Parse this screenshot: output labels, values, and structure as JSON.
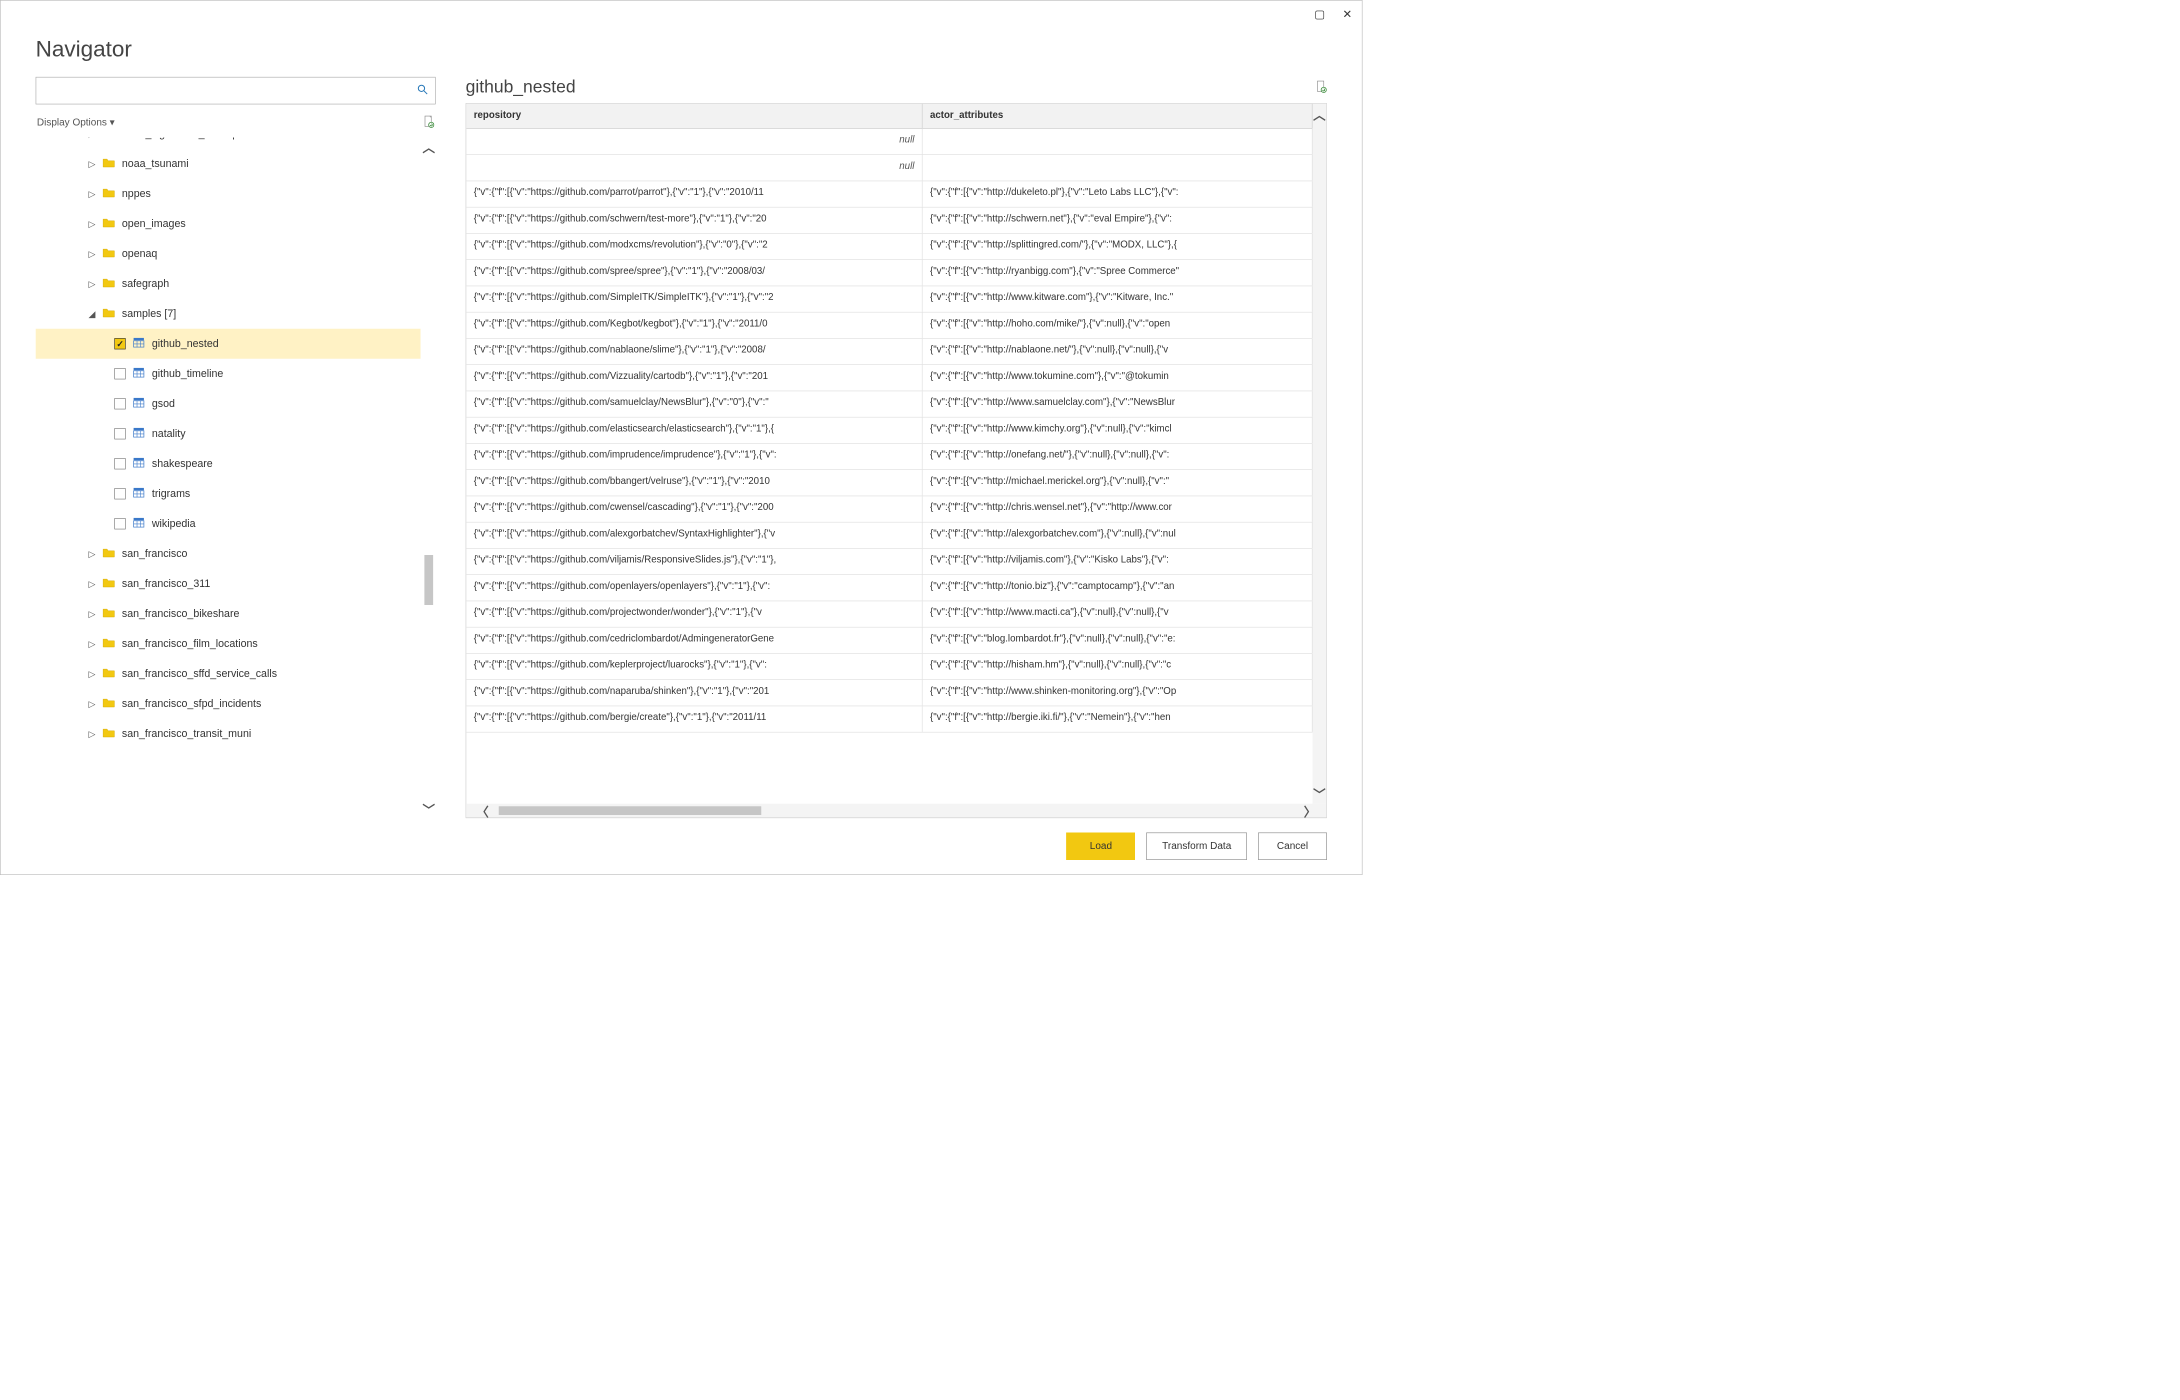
{
  "window": {
    "title": "Navigator",
    "display_options": "Display Options ▾",
    "search_placeholder": ""
  },
  "tree": {
    "items": [
      {
        "level": 2,
        "arrow": "▷",
        "kind": "folder",
        "label": "noaa_significant_earthquakes",
        "trunc": true
      },
      {
        "level": 2,
        "arrow": "▷",
        "kind": "folder",
        "label": "noaa_tsunami"
      },
      {
        "level": 2,
        "arrow": "▷",
        "kind": "folder",
        "label": "nppes"
      },
      {
        "level": 2,
        "arrow": "▷",
        "kind": "folder",
        "label": "open_images"
      },
      {
        "level": 2,
        "arrow": "▷",
        "kind": "folder",
        "label": "openaq"
      },
      {
        "level": 2,
        "arrow": "▷",
        "kind": "folder",
        "label": "safegraph"
      },
      {
        "level": 2,
        "arrow": "◢",
        "kind": "folder",
        "label": "samples [7]"
      },
      {
        "level": 3,
        "kind": "table",
        "checked": true,
        "label": "github_nested",
        "selected": true
      },
      {
        "level": 3,
        "kind": "table",
        "checked": false,
        "label": "github_timeline"
      },
      {
        "level": 3,
        "kind": "table",
        "checked": false,
        "label": "gsod"
      },
      {
        "level": 3,
        "kind": "table",
        "checked": false,
        "label": "natality"
      },
      {
        "level": 3,
        "kind": "table",
        "checked": false,
        "label": "shakespeare"
      },
      {
        "level": 3,
        "kind": "table",
        "checked": false,
        "label": "trigrams"
      },
      {
        "level": 3,
        "kind": "table",
        "checked": false,
        "label": "wikipedia"
      },
      {
        "level": 2,
        "arrow": "▷",
        "kind": "folder",
        "label": "san_francisco"
      },
      {
        "level": 2,
        "arrow": "▷",
        "kind": "folder",
        "label": "san_francisco_311"
      },
      {
        "level": 2,
        "arrow": "▷",
        "kind": "folder",
        "label": "san_francisco_bikeshare"
      },
      {
        "level": 2,
        "arrow": "▷",
        "kind": "folder",
        "label": "san_francisco_film_locations"
      },
      {
        "level": 2,
        "arrow": "▷",
        "kind": "folder",
        "label": "san_francisco_sffd_service_calls"
      },
      {
        "level": 2,
        "arrow": "▷",
        "kind": "folder",
        "label": "san_francisco_sfpd_incidents"
      },
      {
        "level": 2,
        "arrow": "▷",
        "kind": "folder",
        "label": "san_francisco_transit_muni",
        "partial": true
      }
    ]
  },
  "preview": {
    "title": "github_nested",
    "columns": [
      "repository",
      "actor_attributes"
    ],
    "rows": [
      {
        "repository": "null",
        "actor_attributes": "",
        "nullrow": true
      },
      {
        "repository": "null",
        "actor_attributes": "",
        "nullrow": true
      },
      {
        "repository": "{\"v\":{\"f\":[{\"v\":\"https://github.com/parrot/parrot\"},{\"v\":\"1\"},{\"v\":\"2010/11",
        "actor_attributes": "{\"v\":{\"f\":[{\"v\":\"http://dukeleto.pl\"},{\"v\":\"Leto Labs LLC\"},{\"v\":"
      },
      {
        "repository": "{\"v\":{\"f\":[{\"v\":\"https://github.com/schwern/test-more\"},{\"v\":\"1\"},{\"v\":\"20",
        "actor_attributes": "{\"v\":{\"f\":[{\"v\":\"http://schwern.net\"},{\"v\":\"eval Empire\"},{\"v\":"
      },
      {
        "repository": "{\"v\":{\"f\":[{\"v\":\"https://github.com/modxcms/revolution\"},{\"v\":\"0\"},{\"v\":\"2",
        "actor_attributes": "{\"v\":{\"f\":[{\"v\":\"http://splittingred.com/\"},{\"v\":\"MODX, LLC\"},{"
      },
      {
        "repository": "{\"v\":{\"f\":[{\"v\":\"https://github.com/spree/spree\"},{\"v\":\"1\"},{\"v\":\"2008/03/",
        "actor_attributes": "{\"v\":{\"f\":[{\"v\":\"http://ryanbigg.com\"},{\"v\":\"Spree Commerce\""
      },
      {
        "repository": "{\"v\":{\"f\":[{\"v\":\"https://github.com/SimpleITK/SimpleITK\"},{\"v\":\"1\"},{\"v\":\"2",
        "actor_attributes": "{\"v\":{\"f\":[{\"v\":\"http://www.kitware.com\"},{\"v\":\"Kitware, Inc.\""
      },
      {
        "repository": "{\"v\":{\"f\":[{\"v\":\"https://github.com/Kegbot/kegbot\"},{\"v\":\"1\"},{\"v\":\"2011/0",
        "actor_attributes": "{\"v\":{\"f\":[{\"v\":\"http://hoho.com/mike/\"},{\"v\":null},{\"v\":\"open"
      },
      {
        "repository": "{\"v\":{\"f\":[{\"v\":\"https://github.com/nablaone/slime\"},{\"v\":\"1\"},{\"v\":\"2008/",
        "actor_attributes": "{\"v\":{\"f\":[{\"v\":\"http://nablaone.net/\"},{\"v\":null},{\"v\":null},{\"v"
      },
      {
        "repository": "{\"v\":{\"f\":[{\"v\":\"https://github.com/Vizzuality/cartodb\"},{\"v\":\"1\"},{\"v\":\"201",
        "actor_attributes": "{\"v\":{\"f\":[{\"v\":\"http://www.tokumine.com\"},{\"v\":\"@tokumin"
      },
      {
        "repository": "{\"v\":{\"f\":[{\"v\":\"https://github.com/samuelclay/NewsBlur\"},{\"v\":\"0\"},{\"v\":\"",
        "actor_attributes": "{\"v\":{\"f\":[{\"v\":\"http://www.samuelclay.com\"},{\"v\":\"NewsBlur"
      },
      {
        "repository": "{\"v\":{\"f\":[{\"v\":\"https://github.com/elasticsearch/elasticsearch\"},{\"v\":\"1\"},{",
        "actor_attributes": "{\"v\":{\"f\":[{\"v\":\"http://www.kimchy.org\"},{\"v\":null},{\"v\":\"kimcl"
      },
      {
        "repository": "{\"v\":{\"f\":[{\"v\":\"https://github.com/imprudence/imprudence\"},{\"v\":\"1\"},{\"v\":",
        "actor_attributes": "{\"v\":{\"f\":[{\"v\":\"http://onefang.net/\"},{\"v\":null},{\"v\":null},{\"v\":"
      },
      {
        "repository": "{\"v\":{\"f\":[{\"v\":\"https://github.com/bbangert/velruse\"},{\"v\":\"1\"},{\"v\":\"2010",
        "actor_attributes": "{\"v\":{\"f\":[{\"v\":\"http://michael.merickel.org\"},{\"v\":null},{\"v\":\""
      },
      {
        "repository": "{\"v\":{\"f\":[{\"v\":\"https://github.com/cwensel/cascading\"},{\"v\":\"1\"},{\"v\":\"200",
        "actor_attributes": "{\"v\":{\"f\":[{\"v\":\"http://chris.wensel.net\"},{\"v\":\"http://www.cor"
      },
      {
        "repository": "{\"v\":{\"f\":[{\"v\":\"https://github.com/alexgorbatchev/SyntaxHighlighter\"},{\"v",
        "actor_attributes": "{\"v\":{\"f\":[{\"v\":\"http://alexgorbatchev.com\"},{\"v\":null},{\"v\":nul"
      },
      {
        "repository": "{\"v\":{\"f\":[{\"v\":\"https://github.com/viljamis/ResponsiveSlides.js\"},{\"v\":\"1\"},",
        "actor_attributes": "{\"v\":{\"f\":[{\"v\":\"http://viljamis.com\"},{\"v\":\"Kisko Labs\"},{\"v\":"
      },
      {
        "repository": "{\"v\":{\"f\":[{\"v\":\"https://github.com/openlayers/openlayers\"},{\"v\":\"1\"},{\"v\":",
        "actor_attributes": "{\"v\":{\"f\":[{\"v\":\"http://tonio.biz\"},{\"v\":\"camptocamp\"},{\"v\":\"an"
      },
      {
        "repository": "{\"v\":{\"f\":[{\"v\":\"https://github.com/projectwonder/wonder\"},{\"v\":\"1\"},{\"v",
        "actor_attributes": "{\"v\":{\"f\":[{\"v\":\"http://www.macti.ca\"},{\"v\":null},{\"v\":null},{\"v"
      },
      {
        "repository": "{\"v\":{\"f\":[{\"v\":\"https://github.com/cedriclombardot/AdmingeneratorGene",
        "actor_attributes": "{\"v\":{\"f\":[{\"v\":\"blog.lombardot.fr\"},{\"v\":null},{\"v\":null},{\"v\":\"e:"
      },
      {
        "repository": "{\"v\":{\"f\":[{\"v\":\"https://github.com/keplerproject/luarocks\"},{\"v\":\"1\"},{\"v\":",
        "actor_attributes": "{\"v\":{\"f\":[{\"v\":\"http://hisham.hm\"},{\"v\":null},{\"v\":null},{\"v\":\"c"
      },
      {
        "repository": "{\"v\":{\"f\":[{\"v\":\"https://github.com/naparuba/shinken\"},{\"v\":\"1\"},{\"v\":\"201",
        "actor_attributes": "{\"v\":{\"f\":[{\"v\":\"http://www.shinken-monitoring.org\"},{\"v\":\"Op"
      },
      {
        "repository": "{\"v\":{\"f\":[{\"v\":\"https://github.com/bergie/create\"},{\"v\":\"1\"},{\"v\":\"2011/11",
        "actor_attributes": "{\"v\":{\"f\":[{\"v\":\"http://bergie.iki.fi/\"},{\"v\":\"Nemein\"},{\"v\":\"hen"
      }
    ]
  },
  "footer": {
    "load": "Load",
    "transform": "Transform Data",
    "cancel": "Cancel"
  }
}
